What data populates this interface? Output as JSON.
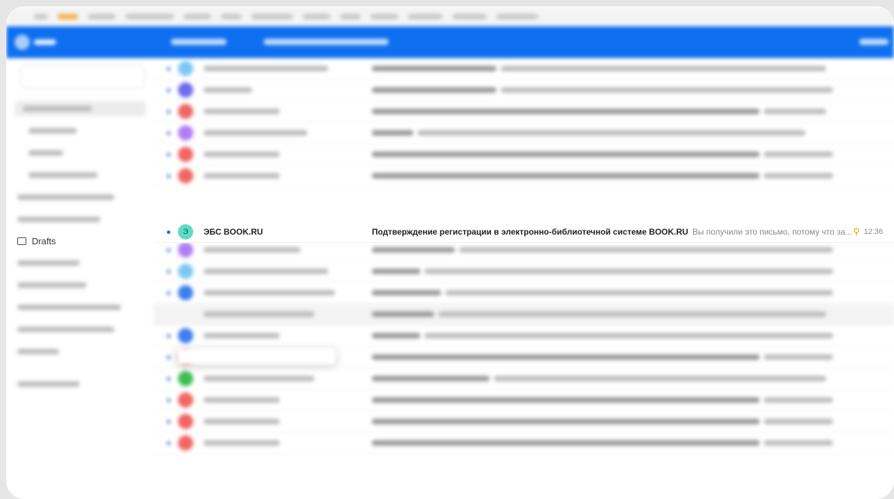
{
  "sidebar": {
    "drafts_label": "Drafts"
  },
  "focused_email": {
    "sender": "ЭБС BOOK.RU",
    "avatar_letter": "Э",
    "subject": "Подтверждение регистрации в электронно-библиотечной системе BOOK.RU",
    "preview": "Вы получили это письмо, потому что за...",
    "time": "12:36",
    "avatar_color": "#5fdcc4",
    "flag_icon": "key-icon"
  },
  "colors": {
    "topbar": "#0d6ff0",
    "unread_dot": "#2b6ad8"
  }
}
